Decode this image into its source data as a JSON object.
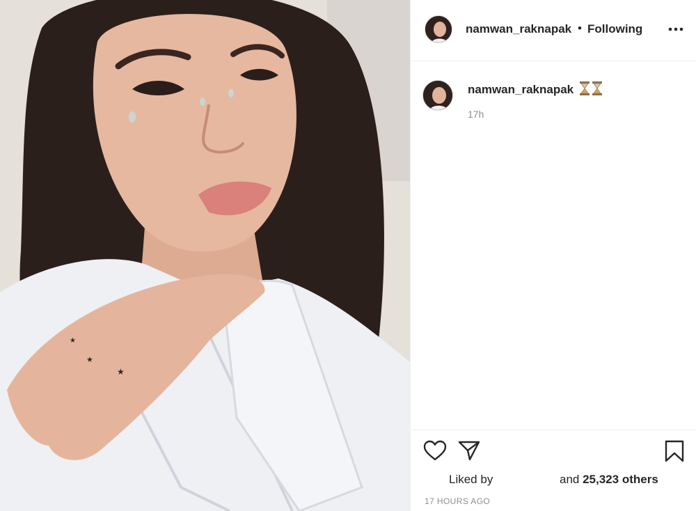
{
  "header": {
    "username": "namwan_raknapak",
    "separator": "•",
    "follow_status": "Following",
    "more_icon": "more-horizontal-icon"
  },
  "caption": {
    "username": "namwan_raknapak",
    "emoji": "hourglass-icon",
    "time": "17h"
  },
  "actions": {
    "like_icon": "heart-icon",
    "share_icon": "paper-plane-icon",
    "save_icon": "bookmark-icon"
  },
  "likes": {
    "prefix": "Liked by",
    "and_text": "and ",
    "count": "25,323",
    "others_text": " others"
  },
  "timestamp": "17 HOURS AGO",
  "photo": {
    "subject": "post-photo",
    "colors": {
      "skin": "#e6b8a0",
      "hair": "#2b1f1b",
      "shirt": "#eef0f4"
    }
  }
}
